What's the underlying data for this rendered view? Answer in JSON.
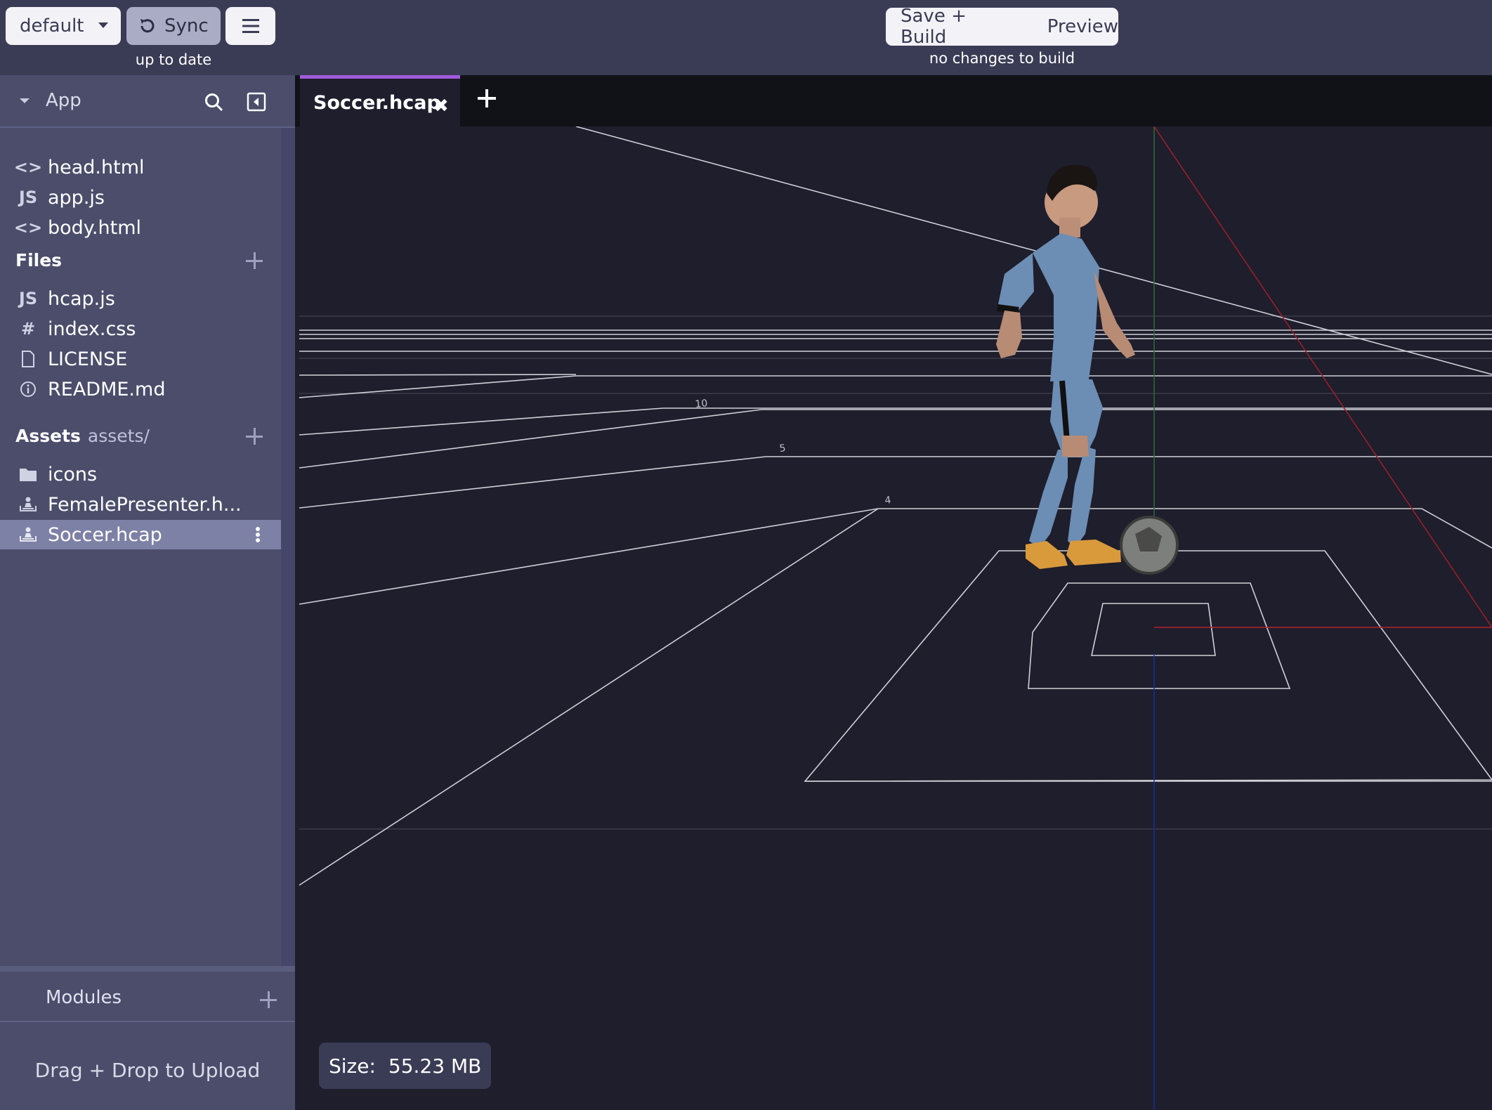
{
  "topbar": {
    "branch": "default",
    "sync_label": "Sync",
    "sync_status": "up to date",
    "save_build_label": "Save + Build",
    "preview_label": "Preview",
    "build_status": "no changes to build"
  },
  "sidebar": {
    "app_label": "App",
    "app_files": [
      {
        "icon": "code-icon",
        "glyph": "<>",
        "name": "head.html"
      },
      {
        "icon": "js-icon",
        "glyph": "JS",
        "name": "app.js"
      },
      {
        "icon": "code-icon",
        "glyph": "<>",
        "name": "body.html"
      }
    ],
    "files_title": "Files",
    "files": [
      {
        "icon": "js-icon",
        "glyph": "JS",
        "name": "hcap.js"
      },
      {
        "icon": "hash-icon",
        "glyph": "#",
        "name": "index.css"
      },
      {
        "icon": "file-icon",
        "glyph": "",
        "name": "LICENSE"
      },
      {
        "icon": "info-icon",
        "glyph": "ⓘ",
        "name": "README.md"
      }
    ],
    "assets_title": "Assets",
    "assets_path": "assets/",
    "assets": [
      {
        "icon": "folder-icon",
        "name": "icons"
      },
      {
        "icon": "hologram-icon",
        "name": "FemalePresenter.h..."
      },
      {
        "icon": "hologram-icon",
        "name": "Soccer.hcap",
        "selected": true
      }
    ],
    "modules_label": "Modules",
    "upload_label": "Drag + Drop to Upload"
  },
  "editor": {
    "active_tab": "Soccer.hcap",
    "grid_labels": [
      "10",
      "5",
      "4"
    ],
    "size_label": "Size:",
    "size_value": "55.23 MB"
  }
}
